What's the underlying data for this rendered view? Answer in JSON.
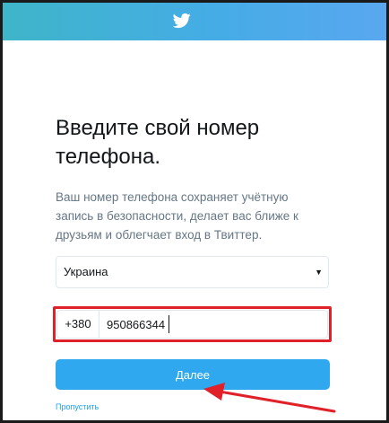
{
  "header": {
    "logo_icon": "twitter-bird-icon",
    "color": "#45ace6"
  },
  "main": {
    "title": "Введите свой номер телефона.",
    "subtitle": "Ваш номер телефона сохраняет учётную запись в безопасности, делает вас ближе к друзьям и облегчает вход в Твиттер.",
    "country_select": {
      "selected": "Украина"
    },
    "phone": {
      "prefix": "+380",
      "value": "950866344"
    },
    "next_button": {
      "label": "Далее",
      "color": "#2fa8ef"
    },
    "skip_link": "Пропустить"
  },
  "annotations": {
    "highlight_color": "#e0212a"
  }
}
